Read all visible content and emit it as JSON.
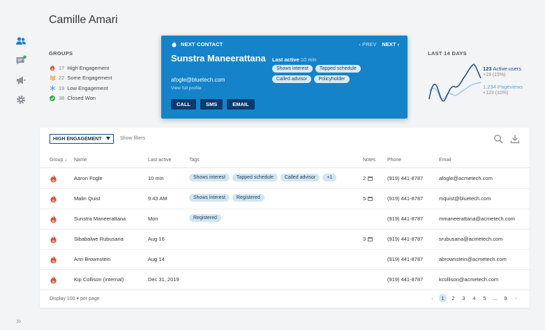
{
  "page": {
    "title": "Camille Amari"
  },
  "sidebar": {
    "items": [
      {
        "icon": "people-icon"
      },
      {
        "icon": "chat-icon"
      },
      {
        "icon": "megaphone-icon"
      },
      {
        "icon": "gear-icon"
      }
    ],
    "expand_label": "»"
  },
  "groups": {
    "label": "GROUPS",
    "items": [
      {
        "count": "17",
        "label": "High Engagement",
        "icon": "fire-icon",
        "color": "#e0462e"
      },
      {
        "count": "22",
        "label": "Some Engagement",
        "icon": "wave-icon",
        "color": "#e89a2c"
      },
      {
        "count": "19",
        "label": "Low Engagement",
        "icon": "snowflake-icon",
        "color": "#4aa3df"
      },
      {
        "count": "38",
        "label": "Closed Won",
        "icon": "check-circle-icon",
        "color": "#3bab55"
      }
    ]
  },
  "next_contact": {
    "header": "NEXT CONTACT",
    "prev_label": "PREV",
    "next_label": "NEXT",
    "name": "Sunstra Maneerattana",
    "email": "afogle@bluetech.com",
    "view_full": "View full profile",
    "actions": [
      "CALL",
      "SMS",
      "EMAIL"
    ],
    "last_active_label": "Last active",
    "last_active_value": "10 min",
    "tags": [
      "Shows interest",
      "Tapped schedule",
      "Called advisor",
      "Policyholder"
    ],
    "bg_color": "#1583c9"
  },
  "stats": {
    "label": "LAST 14 DAYS",
    "active_users_value": "123",
    "active_users_label": "Active users",
    "active_users_delta": "+19 (15%)",
    "pageviews_value": "1,234",
    "pageviews_label": "Pageviews",
    "pageviews_delta": "+123 (10%)"
  },
  "table": {
    "filter_label": "HIGH ENGAGEMENT",
    "show_filters": "Show filters",
    "columns": {
      "group": "Group ↓",
      "name": "Name",
      "last_active": "Last active",
      "tags": "Tags",
      "notes": "Notes",
      "phone": "Phone",
      "email": "Email"
    },
    "rows": [
      {
        "name": "Aaron Fogle",
        "last_active": "10 min",
        "tags": [
          "Shows interest",
          "Tapped schedule",
          "Called advisor",
          "+1"
        ],
        "notes": "2",
        "phone": "(919) 441-8787",
        "email": "afogle@acmetech.com"
      },
      {
        "name": "Malin Quist",
        "last_active": "9:43 AM",
        "tags": [
          "Shows interest",
          "Registered"
        ],
        "notes": "5",
        "phone": "(919) 441-8787",
        "email": "mquist@bluetech.com"
      },
      {
        "name": "Sunstra Maneerattana",
        "last_active": "Mon",
        "tags": [
          "Registered"
        ],
        "notes": "",
        "phone": "(919) 441-8787",
        "email": "mmaneerattana@acmetech.com"
      },
      {
        "name": "Sibabalwe Rubusana",
        "last_active": "Aug 16",
        "tags": [],
        "notes": "3",
        "phone": "(919) 441-8787",
        "email": "srubusana@acmetech.com"
      },
      {
        "name": "Ann Brownstein",
        "last_active": "Aug 14",
        "tags": [],
        "notes": "",
        "phone": "(919) 441-8787",
        "email": "abrownstein@acmetech.com"
      },
      {
        "name": "Kip Collison (internal)",
        "last_active": "Dec 31, 2019",
        "tags": [],
        "notes": "",
        "phone": "(919) 441-8787",
        "email": "kcollison@acmetech.com"
      }
    ],
    "display_label": "Display 100 ▾ per page",
    "pages": [
      "1",
      "2",
      "3",
      "4",
      "5",
      "…",
      "9"
    ],
    "current_page": "1"
  }
}
